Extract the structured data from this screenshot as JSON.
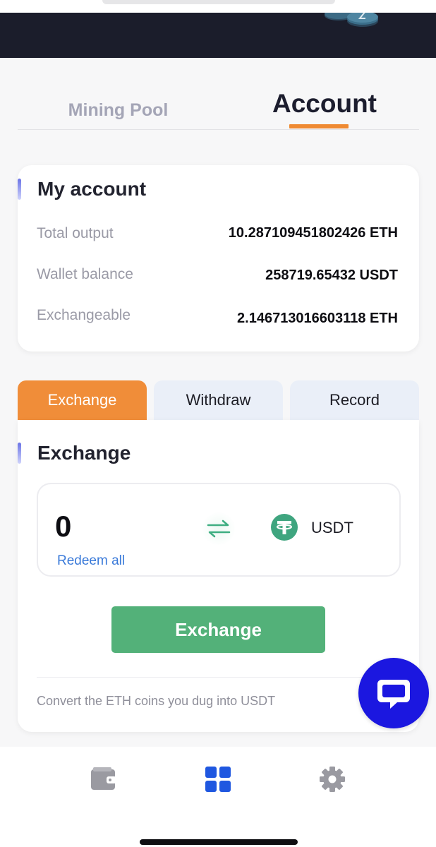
{
  "top_tabs": {
    "mining_pool": "Mining Pool",
    "account": "Account",
    "active": "account"
  },
  "my_account": {
    "title": "My account",
    "rows": [
      {
        "label": "Total output",
        "value": "10.287109451802426 ETH"
      },
      {
        "label": "Wallet balance",
        "value": "258719.65432 USDT"
      },
      {
        "label": "Exchangeable",
        "value": "2.146713016603118 ETH"
      }
    ]
  },
  "sub_tabs": {
    "exchange": "Exchange",
    "withdraw": "Withdraw",
    "record": "Record",
    "active": "exchange"
  },
  "exchange": {
    "title": "Exchange",
    "amount": "0",
    "redeem_all": "Redeem all",
    "target_currency": "USDT",
    "button_label": "Exchange",
    "hint": "Convert the ETH coins you dug into USDT"
  },
  "colors": {
    "accent_orange": "#f08d39",
    "exchange_green": "#53b179",
    "chat_blue": "#1b17e0",
    "link_blue": "#3a7ad9",
    "active_nav_blue": "#1f57e0",
    "tether_green": "#3fa57f"
  },
  "icons": {
    "swap": "swap-arrows-icon",
    "usdt": "tether-icon",
    "chat": "chat-bubble-icon",
    "nav": [
      "wallet-icon",
      "grid-icon",
      "gear-icon"
    ]
  }
}
